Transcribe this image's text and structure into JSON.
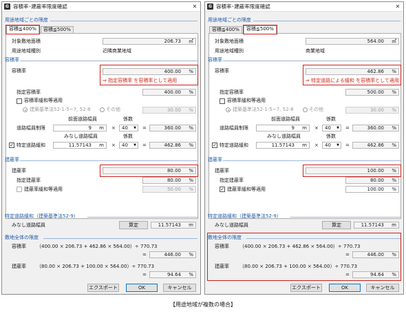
{
  "caption": "【用途地域が複数の場合】",
  "windows": [
    {
      "app_icon": "G",
      "title": "容積率･建蔽率限度確認",
      "close": "✕",
      "section_zone": "用途地域ごとの限度",
      "tabs": [
        "容積≦400%",
        "容積≦500%"
      ],
      "active_tab": 0,
      "site_area_label": "対象敷地面積",
      "site_area_value": "206.73",
      "site_area_unit": "㎡",
      "zone_type_label": "用途地域種別",
      "zone_type_value": "近隣商業地域",
      "far_section": "容積率",
      "far_label": "容積率",
      "far_value": "400.00",
      "percent": "%",
      "far_note": "⇒ 指定容積率 を容積率として適用",
      "designated_far_label": "指定容積率",
      "designated_far_value": "400.00",
      "far_relax_label": "容積率緩和等適用",
      "radio_option1": "建築基準法52-1-5~7, 52-8",
      "radio_option2": "その他",
      "other_value": "30.00",
      "front_road_width_label": "前面道路幅員",
      "coef_label": "係数",
      "road_limit_label": "道路幅員制限",
      "front_road_width_value": "9",
      "m": "m",
      "times": "×",
      "equals": "=",
      "coef_value1": "40",
      "road_limit_value": "360.00",
      "deemed_road_width_label": "みなし道路幅員",
      "coef_label2": "係数",
      "special_road_label": "特定道路緩和",
      "deemed_road_width_value": "11.57143",
      "coef_value2": "40",
      "special_road_value": "462.86",
      "bcr_section": "建蔽率",
      "bcr_label": "建蔽率",
      "bcr_value": "80.00",
      "designated_bcr_label": "指定建蔽率",
      "designated_bcr_value": "80.00",
      "bcr_relax_label": "建蔽率緩和等適用",
      "bcr_relax_checked": false,
      "bcr_relax_value": "50.00",
      "special_road_section": "特定道路緩和（建築基準法52-9）",
      "deemed_label2": "みなし道路幅員",
      "calc_button": "算定",
      "deemed_value2": "11.57143",
      "whole_section": "敷地全体の限度",
      "whole_far_label": "容積率",
      "whole_far_formula": "（400.00 × 206.73 + 462.86 × 564.00）÷ 770.73",
      "whole_far_value": "446.00",
      "whole_bcr_label": "建蔽率",
      "whole_bcr_formula": "（80.00 × 206.73 + 100.00 × 564.00）÷ 770.73",
      "whole_bcr_value": "94.64",
      "export_button": "エクスポート",
      "ok_button": "OK",
      "cancel_button": "キャンセル"
    },
    {
      "app_icon": "G",
      "title": "容積率･建蔽率限度確認",
      "close": "✕",
      "section_zone": "用途地域ごとの限度",
      "tabs": [
        "容積≦400%",
        "容積≦500%"
      ],
      "active_tab": 1,
      "site_area_label": "対象敷地面積",
      "site_area_value": "564.00",
      "site_area_unit": "㎡",
      "zone_type_label": "用途地域種別",
      "zone_type_value": "商業地域",
      "far_section": "容積率",
      "far_label": "容積率",
      "far_value": "462.86",
      "percent": "%",
      "far_note": "⇒ 特定道路による緩和 を容積率として適用",
      "designated_far_label": "指定容積率",
      "designated_far_value": "500.00",
      "far_relax_label": "容積率緩和等適用",
      "radio_option1": "建築基準法52-1-5~7, 52-8",
      "radio_option2": "その他",
      "other_value": "30.00",
      "front_road_width_label": "前面道路幅員",
      "coef_label": "係数",
      "road_limit_label": "道路幅員制限",
      "front_road_width_value": "9",
      "m": "m",
      "times": "×",
      "equals": "=",
      "coef_value1": "40",
      "road_limit_value": "360.00",
      "deemed_road_width_label": "みなし道路幅員",
      "coef_label2": "係数",
      "special_road_label": "特定道路緩和",
      "deemed_road_width_value": "11.57143",
      "coef_value2": "40",
      "special_road_value": "462.86",
      "bcr_section": "建蔽率",
      "bcr_label": "建蔽率",
      "bcr_value": "100.00",
      "designated_bcr_label": "指定建蔽率",
      "designated_bcr_value": "80.00",
      "bcr_relax_label": "建蔽率緩和等適用",
      "bcr_relax_checked": true,
      "bcr_relax_value": "100.00",
      "special_road_section": "特定道路緩和（建築基準法52-9）",
      "deemed_label2": "みなし道路幅員",
      "calc_button": "算定",
      "deemed_value2": "11.57143",
      "whole_section": "敷地全体の限度",
      "whole_far_label": "容積率",
      "whole_far_formula": "（400.00 × 206.73 + 462.86 × 564.00）÷ 770.73",
      "whole_far_value": "446.00",
      "whole_bcr_label": "建蔽率",
      "whole_bcr_formula": "（80.00 × 206.73 + 100.00 × 564.00）÷ 770.73",
      "whole_bcr_value": "94.64",
      "export_button": "エクスポート",
      "ok_button": "OK",
      "cancel_button": "キャンセル"
    }
  ]
}
